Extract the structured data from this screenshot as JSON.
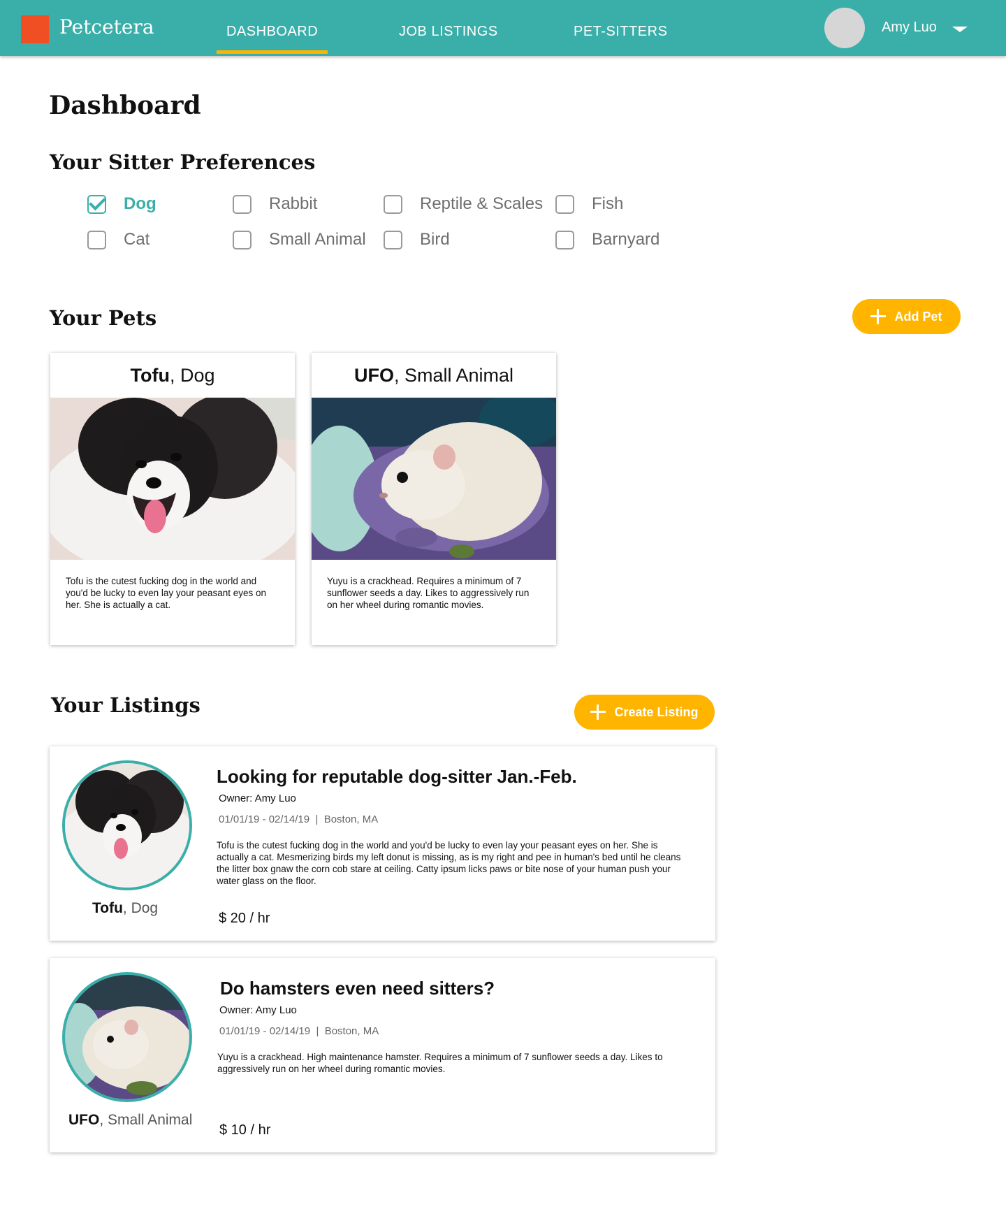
{
  "brand": {
    "name": "Petcetera",
    "logo_color": "#f04e23"
  },
  "nav": {
    "tabs": [
      {
        "label": "DASHBOARD",
        "active": true
      },
      {
        "label": "JOB LISTINGS",
        "active": false
      },
      {
        "label": "PET-SITTERS",
        "active": false
      }
    ],
    "user_name": "Amy Luo",
    "avatar_icon": "user-avatar-placeholder",
    "menu_icon": "caret-down-icon"
  },
  "page": {
    "title": "Dashboard"
  },
  "preferences": {
    "heading": "Your Sitter Preferences",
    "options": [
      {
        "label": "Dog",
        "checked": true
      },
      {
        "label": "Rabbit",
        "checked": false
      },
      {
        "label": "Reptile & Scales",
        "checked": false
      },
      {
        "label": "Fish",
        "checked": false
      },
      {
        "label": "Cat",
        "checked": false
      },
      {
        "label": "Small Animal",
        "checked": false
      },
      {
        "label": "Bird",
        "checked": false
      },
      {
        "label": "Barnyard",
        "checked": false
      }
    ]
  },
  "pets": {
    "heading": "Your Pets",
    "add_button": "Add Pet",
    "items": [
      {
        "name": "Tofu",
        "type": ", Dog",
        "photo": "dog-photo",
        "description": "Tofu is the cutest fucking dog in the world and you'd be lucky to even lay your peasant eyes on her. She is actually a cat."
      },
      {
        "name": "UFO",
        "type": ", Small Animal",
        "photo": "hamster-photo",
        "description": "Yuyu is a crackhead. Requires a minimum of 7 sunflower seeds a day. Likes to aggressively run on her wheel during romantic movies."
      }
    ]
  },
  "listings": {
    "heading": "Your Listings",
    "create_button": "Create Listing",
    "items": [
      {
        "title": "Looking for reputable dog-sitter Jan.-Feb.",
        "owner": "Owner: Amy Luo",
        "dates": "01/01/19 - 02/14/19",
        "separator": "|",
        "location": "Boston, MA",
        "description": "Tofu is the cutest fucking dog in the world and you'd be lucky to even lay your peasant eyes on her. She is actually a cat. Mesmerizing birds my left donut is missing, as is my right and pee in human's bed until he cleans the litter box gnaw the corn cob stare at ceiling. Catty ipsum licks paws or bite nose of your human push your water glass on the floor.",
        "rate": "$ 20 / hr",
        "pet_name": "Tofu",
        "pet_type": ", Dog"
      },
      {
        "title": "Do hamsters even need sitters?",
        "owner": "Owner: Amy Luo",
        "dates": "01/01/19 - 02/14/19",
        "separator": "|",
        "location": "Boston, MA",
        "description": "Yuyu is a crackhead. High maintenance hamster. Requires a minimum of 7 sunflower seeds a day. Likes to aggressively run on her wheel during romantic movies.",
        "rate": "$ 10 / hr",
        "pet_name": "UFO",
        "pet_type": ", Small Animal"
      }
    ]
  },
  "colors": {
    "teal": "#3aafa9",
    "accent": "#ffb400",
    "text": "#111111"
  }
}
